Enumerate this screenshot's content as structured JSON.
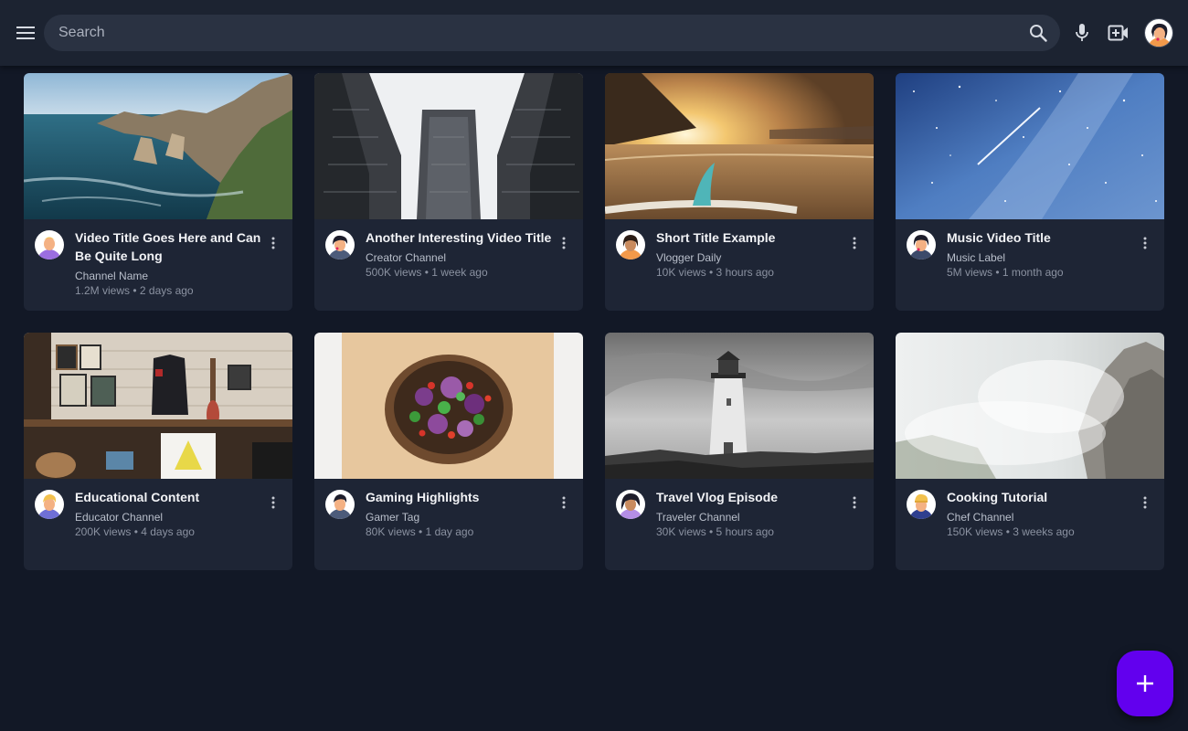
{
  "search": {
    "placeholder": "Search"
  },
  "videos": [
    {
      "title": "Video Title Goes Here and Can Be Quite Long",
      "channel": "Channel Name",
      "stats": "1.2M views • 2 days ago"
    },
    {
      "title": "Another Interesting Video Title",
      "channel": "Creator Channel",
      "stats": "500K views • 1 week ago"
    },
    {
      "title": "Short Title Example",
      "channel": "Vlogger Daily",
      "stats": "10K views • 3 hours ago"
    },
    {
      "title": "Music Video Title",
      "channel": "Music Label",
      "stats": "5M views • 1 month ago"
    },
    {
      "title": "Educational Content",
      "channel": "Educator Channel",
      "stats": "200K views • 4 days ago"
    },
    {
      "title": "Gaming Highlights",
      "channel": "Gamer Tag",
      "stats": "80K views • 1 day ago"
    },
    {
      "title": "Travel Vlog Episode",
      "channel": "Traveler Channel",
      "stats": "30K views • 5 hours ago"
    },
    {
      "title": "Cooking Tutorial",
      "channel": "Chef Channel",
      "stats": "150K views • 3 weeks ago"
    }
  ],
  "colors": {
    "background": "#121826",
    "topbar": "#1c2331",
    "card": "#1e2535",
    "fab": "#6200ee"
  },
  "icons": {
    "menu": "menu-icon",
    "search": "search-icon",
    "mic": "mic-icon",
    "create": "video-add-icon",
    "more": "more-vert-icon",
    "fab": "plus-icon"
  }
}
